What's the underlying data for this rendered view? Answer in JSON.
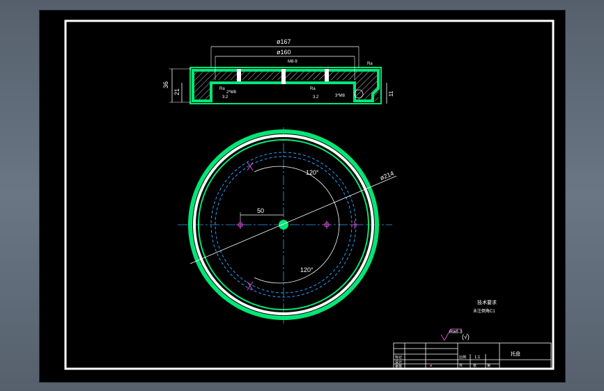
{
  "colors": {
    "background": "#000000",
    "frame": "#ffffff",
    "part_outline": "#00e676",
    "dimension": "#ffffff",
    "hole_marker": "#d050d0",
    "hidden_line": "#29a3ff"
  },
  "section_view": {
    "dim_outer": "ø167",
    "dim_inner": "ø160",
    "dim_height_total": "36",
    "dim_height_inner": "21",
    "dim_right": "11",
    "thread_note": "M8-9",
    "chamfer_note": "2*M8",
    "roughness_top": "Ra",
    "roughness_mid_1": "Ra",
    "roughness_mid_1_val": "3.2",
    "roughness_mid_2": "Ra",
    "roughness_mid_2_val": "3.2",
    "bottom_note": "3*M8"
  },
  "plan_view": {
    "dim_diameter": "ø214",
    "dim_radius": "50",
    "angle_top": "120°",
    "angle_bottom": "120°"
  },
  "notes": {
    "tech_title": "技术要求",
    "tech_line": "未注倒角C1"
  },
  "surface_finish": {
    "label": "Ra6.3",
    "paren": "(√)"
  },
  "title_block": {
    "scale": "1:1",
    "part_name": "托盘",
    "mark_1": "标记",
    "mark_2": "设计",
    "mark_3": "审核",
    "mark_4": "比例",
    "mark_5": "共",
    "mark_6": "张",
    "mark_7": "第"
  }
}
